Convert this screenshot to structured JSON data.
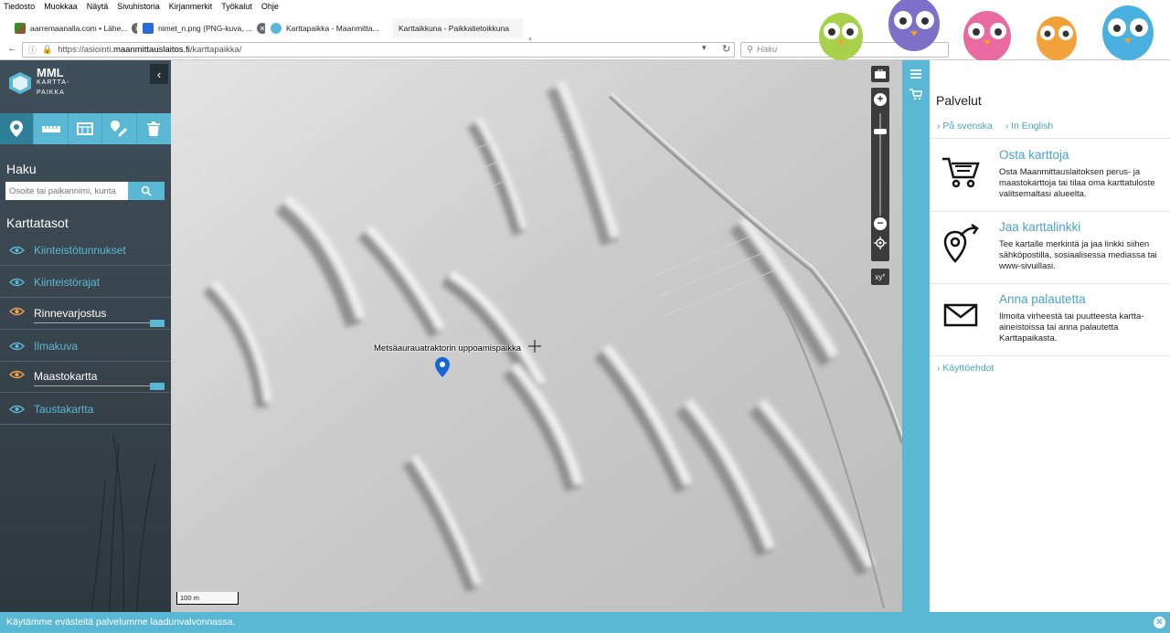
{
  "browser": {
    "menu": [
      "Tiedosto",
      "Muokkaa",
      "Näytä",
      "Sivuhistoria",
      "Kirjanmerkit",
      "Työkalut",
      "Ohje"
    ],
    "tabs": [
      {
        "label": "aarremaanalla.com • Lähe..."
      },
      {
        "label": "nimet_n.png (PNG-kuva, ..."
      },
      {
        "label": "Karttapaikka - Maanmitta..."
      },
      {
        "label": "Karttaikkuna - Paikkatietoikkuna"
      }
    ],
    "url_prefix": "https://asiointi.",
    "url_domain": "maanmittauslaitos.fi",
    "url_path": "/karttapaikka/",
    "search_placeholder": "Haku"
  },
  "logo": {
    "main": "MML",
    "sub1": "KARTTA-",
    "sub2": "PAIKKA"
  },
  "left": {
    "haku_title": "Haku",
    "search_placeholder": "Osoite tai paikannimi, kunta",
    "layers_title": "Karttatasot",
    "layers": [
      {
        "label": "Kiinteistötunnukset",
        "visible": false
      },
      {
        "label": "Kiinteistörajat",
        "visible": false
      },
      {
        "label": "Rinnevarjostus",
        "visible": true,
        "opacity": 1.0
      },
      {
        "label": "Ilmakuva",
        "visible": false
      },
      {
        "label": "Maastokartta",
        "visible": true,
        "opacity": 1.0
      },
      {
        "label": "Taustakartta",
        "visible": false
      }
    ]
  },
  "map": {
    "marker_label": "Metsäaurauatraktorin uppoamispaikka",
    "scale": "100 m",
    "coord_btn": "xy°"
  },
  "right": {
    "title": "Palvelut",
    "langs": [
      "På svenska",
      "In English"
    ],
    "services": [
      {
        "title": "Osta karttoja",
        "desc": "Osta Maanmittauslaitoksen perus- ja maastokarttoja tai tilaa oma karttatuloste valitsemaltasi alueelta.",
        "icon": "cart-icon"
      },
      {
        "title": "Jaa karttalinkki",
        "desc": "Tee kartalle merkintä ja jaa linkki siihen sähköpostilla, sosiaalisessa mediassa tai www-sivuillasi.",
        "icon": "share-location-icon"
      },
      {
        "title": "Anna palautetta",
        "desc": "Ilmoita virheestä tai puutteesta kartta-aineistoissa tai anna palautetta Karttapaikasta.",
        "icon": "envelope-icon"
      }
    ],
    "terms": "Käyttöehdot"
  },
  "cookie": {
    "text": "Käytämme evästeitä palvelumme laadunvalvonnassa."
  },
  "colors": {
    "accent": "#5bb8d4",
    "panel": "#3e4e5a",
    "link": "#4aa3c8",
    "marker": "#1565d8"
  }
}
